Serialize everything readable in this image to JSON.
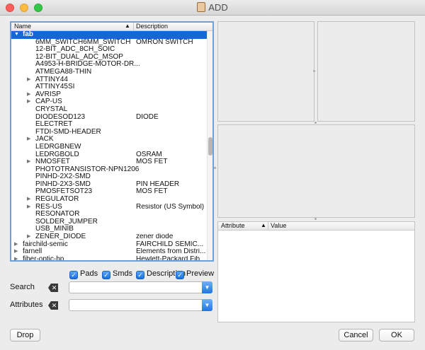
{
  "window": {
    "title": "ADD"
  },
  "tree": {
    "columns": {
      "name": "Name",
      "description": "Description"
    },
    "rows": [
      {
        "name": "fab",
        "desc": "",
        "level": 0,
        "arrow": "open",
        "selected": true
      },
      {
        "name": "6MM_SWITCH6MM_SWITCH",
        "desc": "OMRON SWITCH",
        "level": 1,
        "arrow": "none"
      },
      {
        "name": "12-BIT_ADC_8CH_SOIC",
        "desc": "",
        "level": 1,
        "arrow": "none"
      },
      {
        "name": "12-BIT_DUAL_ADC_MSOP",
        "desc": "",
        "level": 1,
        "arrow": "none"
      },
      {
        "name": "A4953-H-BRIDGE-MOTOR-DR...",
        "desc": "",
        "level": 1,
        "arrow": "none"
      },
      {
        "name": "ATMEGA88-THIN",
        "desc": "",
        "level": 1,
        "arrow": "none"
      },
      {
        "name": "ATTINY44",
        "desc": "",
        "level": 1,
        "arrow": "closed"
      },
      {
        "name": "ATTINY45SI",
        "desc": "",
        "level": 1,
        "arrow": "none"
      },
      {
        "name": "AVRISP",
        "desc": "",
        "level": 1,
        "arrow": "closed"
      },
      {
        "name": "CAP-US",
        "desc": "",
        "level": 1,
        "arrow": "closed"
      },
      {
        "name": "CRYSTAL",
        "desc": "",
        "level": 1,
        "arrow": "none"
      },
      {
        "name": "DIODESOD123",
        "desc": "DIODE",
        "level": 1,
        "arrow": "none"
      },
      {
        "name": "ELECTRET",
        "desc": "",
        "level": 1,
        "arrow": "none"
      },
      {
        "name": "FTDI-SMD-HEADER",
        "desc": "",
        "level": 1,
        "arrow": "none"
      },
      {
        "name": "JACK",
        "desc": "",
        "level": 1,
        "arrow": "closed"
      },
      {
        "name": "LEDRGBNEW",
        "desc": "",
        "level": 1,
        "arrow": "none"
      },
      {
        "name": "LEDRGBOLD",
        "desc": "OSRAM",
        "level": 1,
        "arrow": "none"
      },
      {
        "name": "NMOSFET",
        "desc": "MOS FET",
        "level": 1,
        "arrow": "closed"
      },
      {
        "name": "PHOTOTRANSISTOR-NPN1206",
        "desc": "",
        "level": 1,
        "arrow": "none"
      },
      {
        "name": "PINHD-2X2-SMD",
        "desc": "",
        "level": 1,
        "arrow": "none"
      },
      {
        "name": "PINHD-2X3-SMD",
        "desc": "PIN HEADER",
        "level": 1,
        "arrow": "none"
      },
      {
        "name": "PMOSFETSOT23",
        "desc": "MOS FET",
        "level": 1,
        "arrow": "none"
      },
      {
        "name": "REGULATOR",
        "desc": "",
        "level": 1,
        "arrow": "closed"
      },
      {
        "name": "RES-US",
        "desc": "Resistor (US Symbol)",
        "level": 1,
        "arrow": "closed"
      },
      {
        "name": "RESONATOR",
        "desc": "",
        "level": 1,
        "arrow": "none"
      },
      {
        "name": "SOLDER_JUMPER",
        "desc": "",
        "level": 1,
        "arrow": "none"
      },
      {
        "name": "USB_MINIB",
        "desc": "",
        "level": 1,
        "arrow": "none"
      },
      {
        "name": "ZENER_DIODE",
        "desc": "zener diode",
        "level": 1,
        "arrow": "closed"
      },
      {
        "name": "fairchild-semic",
        "desc": "FAIRCHILD SEMIC...",
        "level": 0,
        "arrow": "closed"
      },
      {
        "name": "farnell",
        "desc": "Elements from Distri...",
        "level": 0,
        "arrow": "closed"
      },
      {
        "name": "fiber-optic-hp",
        "desc": "Hewlett-Packard Fib...",
        "level": 0,
        "arrow": "closed"
      }
    ]
  },
  "attributes_table": {
    "columns": {
      "attribute": "Attribute",
      "value": "Value"
    }
  },
  "options": {
    "pads": "Pads",
    "smds": "Smds",
    "description": "Description",
    "preview": "Preview"
  },
  "search": {
    "label": "Search",
    "value": ""
  },
  "attributes": {
    "label": "Attributes",
    "value": ""
  },
  "buttons": {
    "drop": "Drop",
    "cancel": "Cancel",
    "ok": "OK"
  },
  "colors": {
    "selection": "#1566d8",
    "focus_ring": "#6ea0dc",
    "checkbox": "#2a7de8"
  }
}
